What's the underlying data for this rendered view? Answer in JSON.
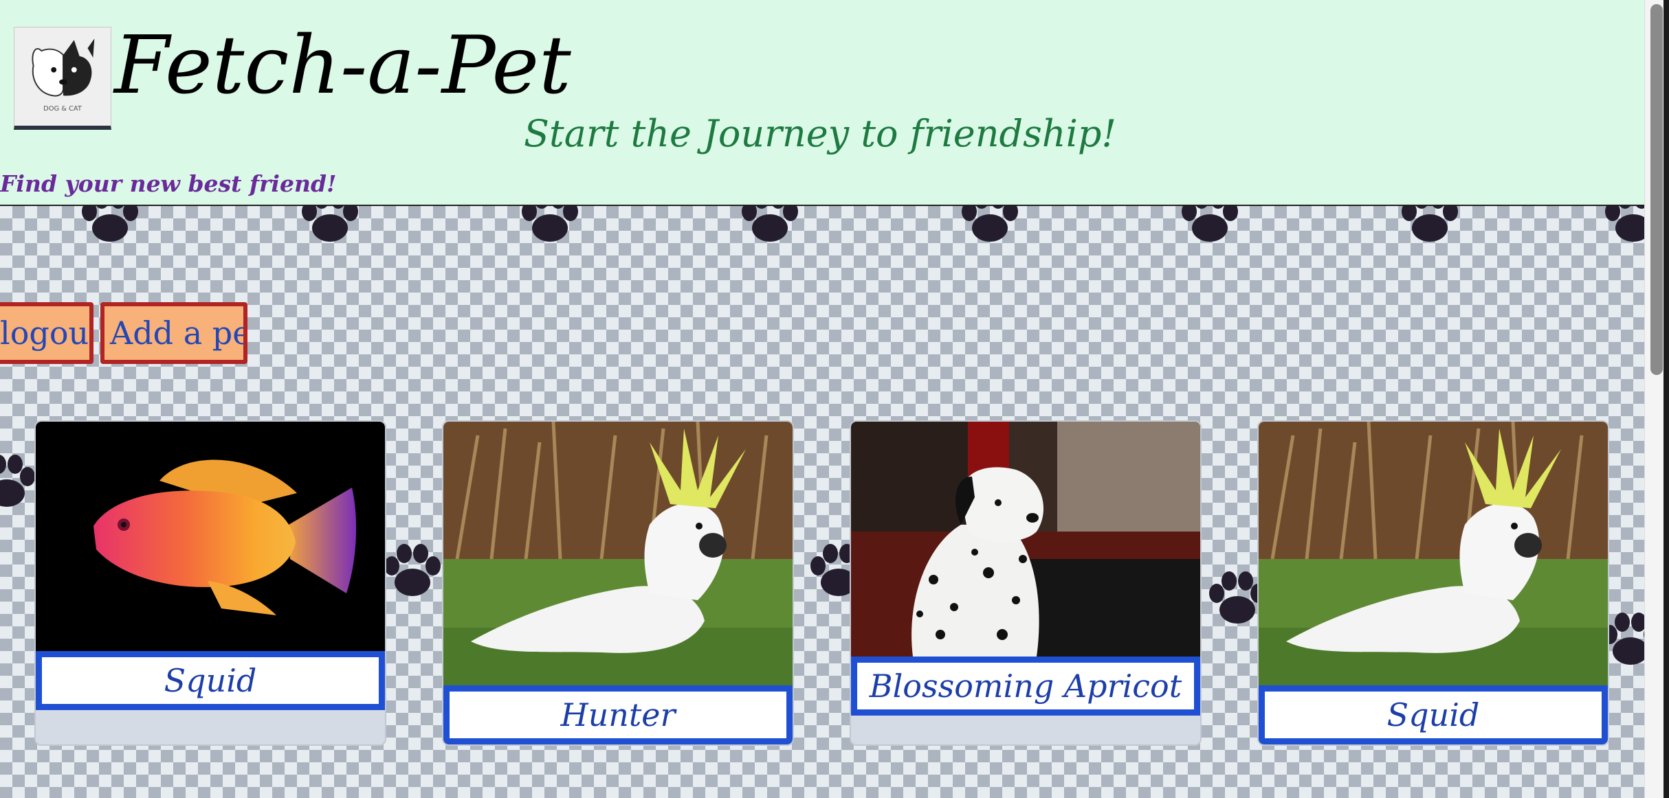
{
  "header": {
    "title": "Fetch-a-Pet",
    "tagline": "Start the Journey to friendship!",
    "subtagline": "Find your new best friend!",
    "logo": {
      "icon": "dog-and-cat-logo",
      "text": "DOG & CAT"
    }
  },
  "actions": {
    "logout_label": "logout",
    "add_pet_label": "Add a pet"
  },
  "pets": [
    {
      "name": "Squid",
      "image": "fish-photo"
    },
    {
      "name": "Hunter",
      "image": "cockatoo-photo"
    },
    {
      "name": "Blossoming Apricot",
      "image": "dalmatian-puppy-photo"
    },
    {
      "name": "Squid",
      "image": "cockatoo-photo"
    }
  ],
  "colors": {
    "header_bg": "#dbf9e7",
    "tagline": "#1d7a40",
    "subtagline": "#6a2a9a",
    "button_bg": "#f8b178",
    "button_border": "#b02424",
    "button_text": "#2447b6",
    "card_name_border": "#1f4fd3",
    "card_name_text": "#1c3ea8"
  }
}
